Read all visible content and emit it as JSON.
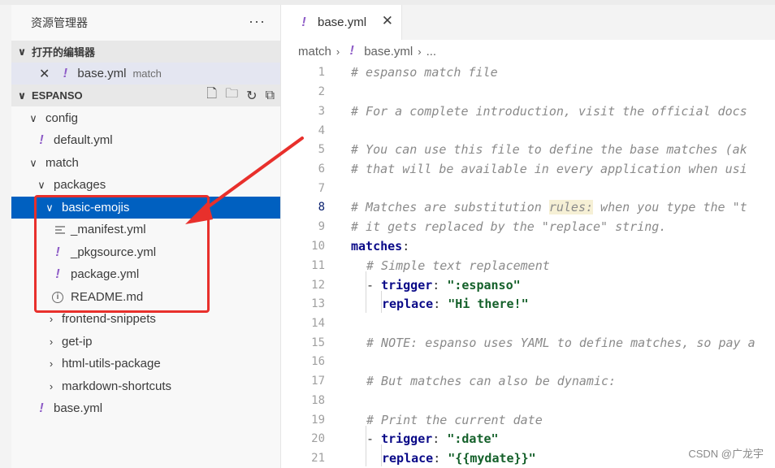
{
  "explorer": {
    "title": "资源管理器",
    "more_label": "···",
    "open_editors": {
      "header": "打开的编辑器",
      "items": [
        {
          "close": "✕",
          "file": "base.yml",
          "desc": "match"
        }
      ]
    },
    "workspace": {
      "header": "ESPANSO",
      "tree": {
        "config": "config",
        "default": "default.yml",
        "match": "match",
        "packages": "packages",
        "basic_emojis": "basic-emojis",
        "manifest": "_manifest.yml",
        "pkgsource": "_pkgsource.yml",
        "package": "package.yml",
        "readme": "README.md",
        "frontend": "frontend-snippets",
        "get_ip": "get-ip",
        "html_utils": "html-utils-package",
        "markdown": "markdown-shortcuts",
        "base": "base.yml"
      }
    },
    "icons": [
      "new-file-icon",
      "new-folder-icon",
      "refresh-icon",
      "collapse-all-icon"
    ]
  },
  "editor": {
    "tab": {
      "label": "base.yml",
      "close": "✕"
    },
    "breadcrumb": {
      "folder": "match",
      "file": "base.yml",
      "more": "..."
    },
    "lines": {
      "l1": "# espanso match file",
      "l3": "# For a complete introduction, visit the official docs",
      "l5": "# You can use this file to define the base matches (ak",
      "l6": "# that will be available in every application when usi",
      "l8a": "# Matches are substitution ",
      "l8b": "rules:",
      "l8c": " when you type the \"t",
      "l9": "# it gets replaced by the \"replace\" string.",
      "l10key": "matches",
      "l11": "# Simple text replacement",
      "l12key": "trigger",
      "l12val": "\":espanso\"",
      "l13key": "replace",
      "l13val": "\"Hi there!\"",
      "l15": "# NOTE: espanso uses YAML to define matches, so pay a",
      "l17": "# But matches can also be dynamic:",
      "l19": "# Print the current date",
      "l20key": "trigger",
      "l20val": "\":date\"",
      "l21key": "replace",
      "l21val": "\"{{mydate}}\""
    },
    "line_numbers": [
      "1",
      "2",
      "3",
      "4",
      "5",
      "6",
      "7",
      "8",
      "9",
      "10",
      "11",
      "12",
      "13",
      "14",
      "15",
      "16",
      "17",
      "18",
      "19",
      "20",
      "21"
    ],
    "active_line": "8"
  },
  "watermark": "CSDN @广龙宇",
  "colors": {
    "selection": "#0060c0",
    "annotation_red": "#e8302c",
    "yaml_icon": "#8e5cc7"
  }
}
